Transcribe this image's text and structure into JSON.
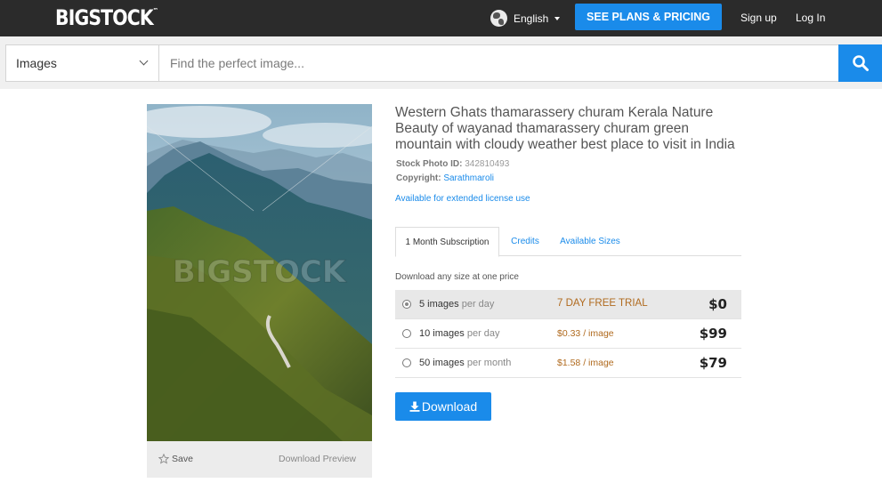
{
  "header": {
    "logo_text": "BIGSTOCK",
    "logo_mark": "™",
    "language": "English",
    "plans_button": "SEE PLANS & PRICING",
    "signup": "Sign up",
    "login": "Log In"
  },
  "search": {
    "category": "Images",
    "placeholder": "Find the perfect image...",
    "icon": "search-icon"
  },
  "preview": {
    "watermark": "BIGSTOCK",
    "save": "Save",
    "download_preview": "Download Preview"
  },
  "photo": {
    "title": "Western Ghats thamarassery churam Kerala Nature Beauty of wayanad thamarassery churam green mountain with cloudy weather best place to visit in India",
    "id_label": "Stock Photo ID:",
    "id_value": "342810493",
    "copyright_label": "Copyright:",
    "copyright_value": "Sarathmaroli",
    "extended_license": "Available for extended license use"
  },
  "tabs": [
    {
      "label": "1 Month Subscription",
      "active": true
    },
    {
      "label": "Credits",
      "active": false
    },
    {
      "label": "Available Sizes",
      "active": false
    }
  ],
  "pricing": {
    "intro": "Download any size at one price",
    "plans": [
      {
        "count": "5 images",
        "unit": "per day",
        "rate": "7 DAY FREE TRIAL",
        "total": "$0",
        "selected": true
      },
      {
        "count": "10 images",
        "unit": "per day",
        "rate": "$0.33 / image",
        "total": "$99",
        "selected": false
      },
      {
        "count": "50 images",
        "unit": "per month",
        "rate": "$1.58 / image",
        "total": "$79",
        "selected": false
      }
    ]
  },
  "download_button": "Download",
  "colors": {
    "topbar": "#2b2b2b",
    "accent": "#1a8bea",
    "price_rate": "#b06a1e"
  }
}
